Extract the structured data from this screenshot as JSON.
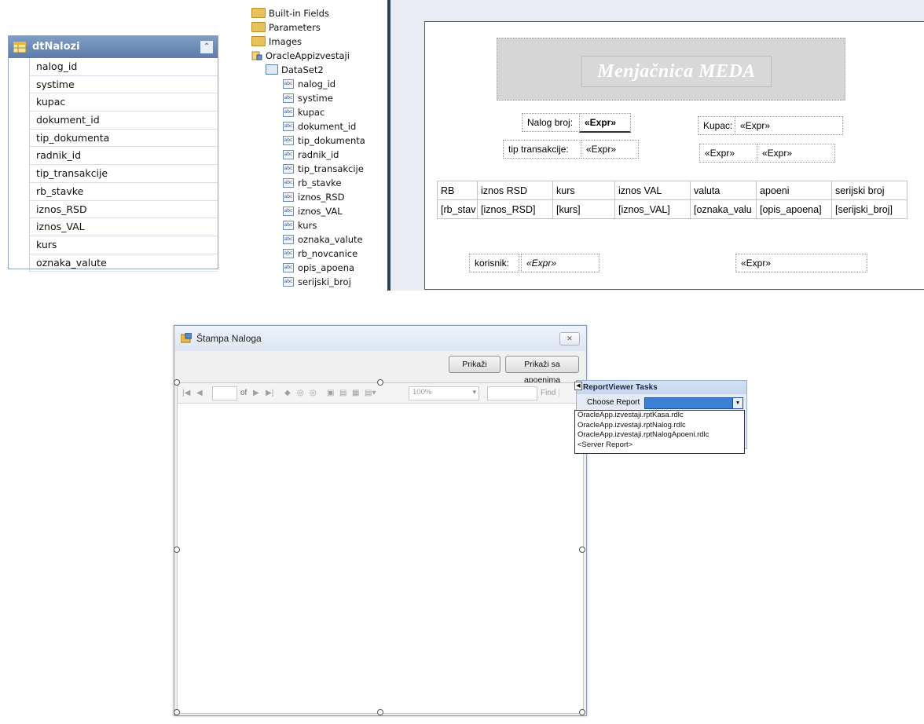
{
  "dt_table": {
    "title": "dtNalozi",
    "collapse_glyph": "⌃",
    "fields": [
      "nalog_id",
      "systime",
      "kupac",
      "dokument_id",
      "tip_dokumenta",
      "radnik_id",
      "tip_transakcije",
      "rb_stavke",
      "iznos_RSD",
      "iznos_VAL",
      "kurs",
      "oznaka_valute"
    ]
  },
  "tree": {
    "builtin": "Built-in Fields",
    "parameters": "Parameters",
    "images": "Images",
    "datasource": "OracleAppizvestaji",
    "dataset": "DataSet2",
    "field_icon_text": "abc",
    "fields": [
      "nalog_id",
      "systime",
      "kupac",
      "dokument_id",
      "tip_dokumenta",
      "radnik_id",
      "tip_transakcije",
      "rb_stavke",
      "iznos_RSD",
      "iznos_VAL",
      "kurs",
      "oznaka_valute",
      "rb_novcanice",
      "opis_apoena",
      "serijski_broj"
    ]
  },
  "report": {
    "title": "Menjačnica MEDA",
    "nalog_label": "Nalog broj:",
    "nalog_expr": "«Expr»",
    "kupac_label": "Kupac:",
    "kupac_expr": "«Expr»",
    "tip_label": "tip transakcije:",
    "tip_expr": "«Expr»",
    "expr_a": "«Expr»",
    "expr_b": "«Expr»",
    "table_headers": [
      "RB",
      "iznos RSD",
      "kurs",
      "iznos VAL",
      "valuta",
      "apoeni",
      "serijski broj"
    ],
    "table_row": [
      "[rb_stav",
      "[iznos_RSD]",
      "[kurs]",
      "[iznos_VAL]",
      "[oznaka_valu",
      "[opis_apoena]",
      "[serijski_broj]"
    ],
    "korisnik_label": "korisnik:",
    "korisnik_expr": "«Expr»",
    "footer_expr": "«Expr»"
  },
  "window": {
    "title": "Štampa Naloga",
    "close_glyph": "✕",
    "btn_prikazi": "Prikaži",
    "btn_prikazi_apoeni": "Prikaži sa apoenima",
    "toolbar": {
      "first": "|◀",
      "prev": "◀",
      "of": "of",
      "next": "▶",
      "last": "▶|",
      "back": "◆",
      "stop": "◎",
      "refresh": "◎",
      "print": "▣",
      "layout": "▤",
      "setup": "▦",
      "export": "▤▾",
      "zoom": "100%",
      "zoom_dd": "▾",
      "find": "Find",
      "find_sep": "|"
    }
  },
  "tasks": {
    "title": "ReportViewer Tasks",
    "arrow": "◀",
    "choose_label": "Choose Report",
    "dd_glyph": "▼",
    "options": [
      "OracleApp.izvestaji.rptKasa.rdlc",
      "OracleApp.izvestaji.rptNalog.rdlc",
      "OracleApp.izvestaji.rptNalogApoeni.rdlc",
      "<Server Report>"
    ]
  },
  "colors": {
    "dt_header": "#6a88b6",
    "designer_bg": "#e9ecf2",
    "title_band": "#d6d6d6",
    "combo_selected": "#3e7fd6"
  }
}
